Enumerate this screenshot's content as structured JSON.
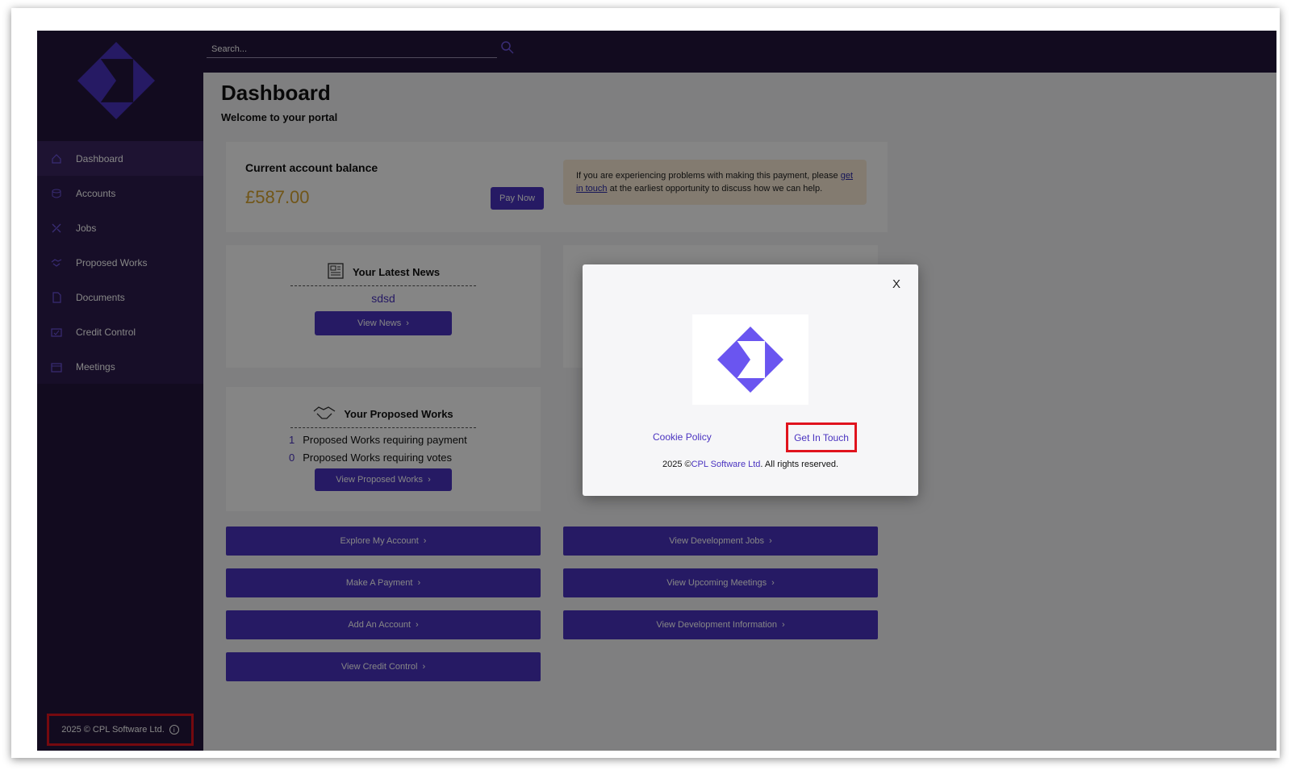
{
  "search": {
    "placeholder": "Search..."
  },
  "sidebar": {
    "items": [
      {
        "label": "Dashboard",
        "icon": "home-icon"
      },
      {
        "label": "Accounts",
        "icon": "coins-icon"
      },
      {
        "label": "Jobs",
        "icon": "tools-icon"
      },
      {
        "label": "Proposed Works",
        "icon": "handshake-icon"
      },
      {
        "label": "Documents",
        "icon": "document-icon"
      },
      {
        "label": "Credit Control",
        "icon": "credit-icon"
      },
      {
        "label": "Meetings",
        "icon": "calendar-icon"
      }
    ],
    "footer": "2025 © CPL Software Ltd."
  },
  "page": {
    "title": "Dashboard",
    "subtitle": "Welcome to your portal"
  },
  "balance": {
    "title": "Current account balance",
    "amount": "£587.00",
    "pay_label": "Pay Now",
    "notice_pre": "If you are experiencing problems with making this payment, please",
    "notice_link": "get in touch",
    "notice_post": "at the earliest opportunity to discuss how we can help."
  },
  "news": {
    "title": "Your Latest News",
    "item": "sdsd",
    "button": "View News"
  },
  "works": {
    "title": "Your Proposed Works",
    "payment_count": "1",
    "payment_label": "Proposed Works requiring payment",
    "votes_count": "0",
    "votes_label": "Proposed Works requiring votes",
    "button": "View Proposed Works"
  },
  "actions_left": [
    "Explore My Account",
    "Make A Payment",
    "Add An Account",
    "View Credit Control"
  ],
  "actions_right": [
    "View Development Jobs",
    "View Upcoming Meetings",
    "View Development Information"
  ],
  "modal": {
    "close": "X",
    "cookie": "Cookie Policy",
    "get_in_touch": "Get In Touch",
    "copy_pre": "2025 ©",
    "copy_brand": "CPL Software Ltd",
    "copy_post": ". All rights reserved."
  },
  "colors": {
    "brand": "#4a33c0",
    "sidebar": "#24163d",
    "amount": "#d9a52f",
    "highlight": "#e0131d"
  }
}
